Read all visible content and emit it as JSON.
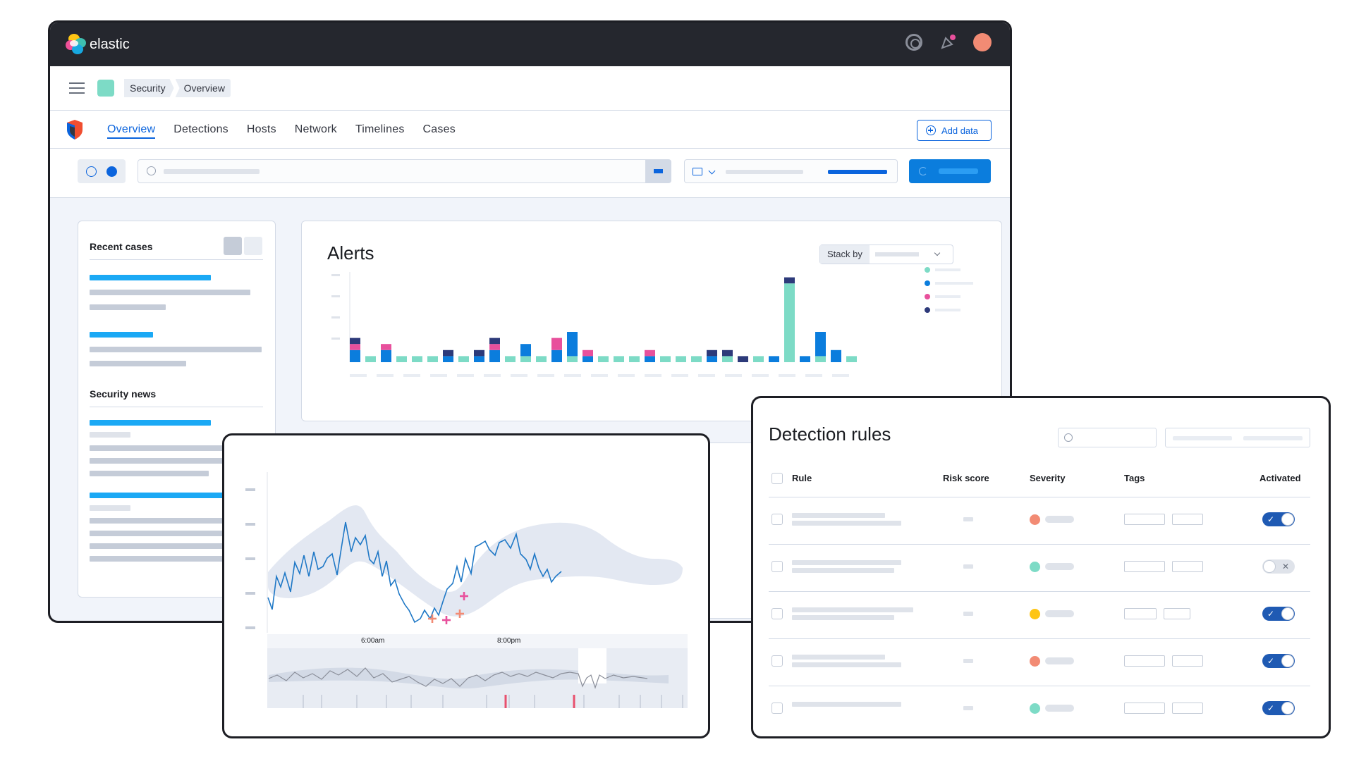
{
  "brand": {
    "name": "elastic"
  },
  "breadcrumbs": [
    "Security",
    "Overview"
  ],
  "tabs": [
    {
      "label": "Overview",
      "active": true
    },
    {
      "label": "Detections",
      "active": false
    },
    {
      "label": "Hosts",
      "active": false
    },
    {
      "label": "Network",
      "active": false
    },
    {
      "label": "Timelines",
      "active": false
    },
    {
      "label": "Cases",
      "active": false
    }
  ],
  "actions": {
    "add_data": "Add data"
  },
  "panels": {
    "recent_cases": "Recent cases",
    "security_news": "Security news"
  },
  "alerts": {
    "title": "Alerts",
    "stack_by": "Stack by",
    "chart_data": {
      "type": "bar",
      "series_colors": [
        "#7ddbc6",
        "#0b7ddd",
        "#e8509c",
        "#2d3a7a"
      ],
      "stacks": [
        [
          0,
          2,
          1,
          1
        ],
        [
          1,
          0,
          0,
          0
        ],
        [
          0,
          2,
          1,
          0
        ],
        [
          1,
          0,
          0,
          0
        ],
        [
          1,
          0,
          0,
          0
        ],
        [
          1,
          0,
          0,
          0
        ],
        [
          0,
          1,
          0,
          1
        ],
        [
          1,
          0,
          0,
          0
        ],
        [
          0,
          1,
          0,
          1
        ],
        [
          0,
          2,
          1,
          1
        ],
        [
          1,
          0,
          0,
          0
        ],
        [
          1,
          2,
          0,
          0
        ],
        [
          1,
          0,
          0,
          0
        ],
        [
          0,
          2,
          2,
          0
        ],
        [
          1,
          4,
          0,
          0
        ],
        [
          0,
          1,
          1,
          0
        ],
        [
          1,
          0,
          0,
          0
        ],
        [
          1,
          0,
          0,
          0
        ],
        [
          1,
          0,
          0,
          0
        ],
        [
          0,
          1,
          1,
          0
        ],
        [
          1,
          0,
          0,
          0
        ],
        [
          1,
          0,
          0,
          0
        ],
        [
          1,
          0,
          0,
          0
        ],
        [
          0,
          1,
          0,
          1
        ],
        [
          1,
          0,
          0,
          1
        ],
        [
          0,
          0,
          0,
          1
        ],
        [
          1,
          0,
          0,
          0
        ],
        [
          0,
          1,
          0,
          0
        ],
        [
          13,
          0,
          0,
          1
        ],
        [
          0,
          1,
          0,
          0
        ],
        [
          1,
          4,
          0,
          0
        ],
        [
          0,
          2,
          0,
          0
        ],
        [
          1,
          0,
          0,
          0
        ]
      ]
    }
  },
  "anomaly": {
    "time_labels": [
      "6:00am",
      "8:00pm"
    ]
  },
  "detection_rules": {
    "title": "Detection rules",
    "columns": [
      "Rule",
      "Risk score",
      "Severity",
      "Tags",
      "Activated"
    ],
    "rows": [
      {
        "severity_color": "#f28b74",
        "activated": true
      },
      {
        "severity_color": "#7ddbc6",
        "activated": false
      },
      {
        "severity_color": "#fec514",
        "activated": true
      },
      {
        "severity_color": "#f28b74",
        "activated": true
      },
      {
        "severity_color": "#7ddbc6",
        "activated": true
      }
    ]
  },
  "icons": {
    "on_mark": "✓",
    "off_mark": "✕"
  }
}
